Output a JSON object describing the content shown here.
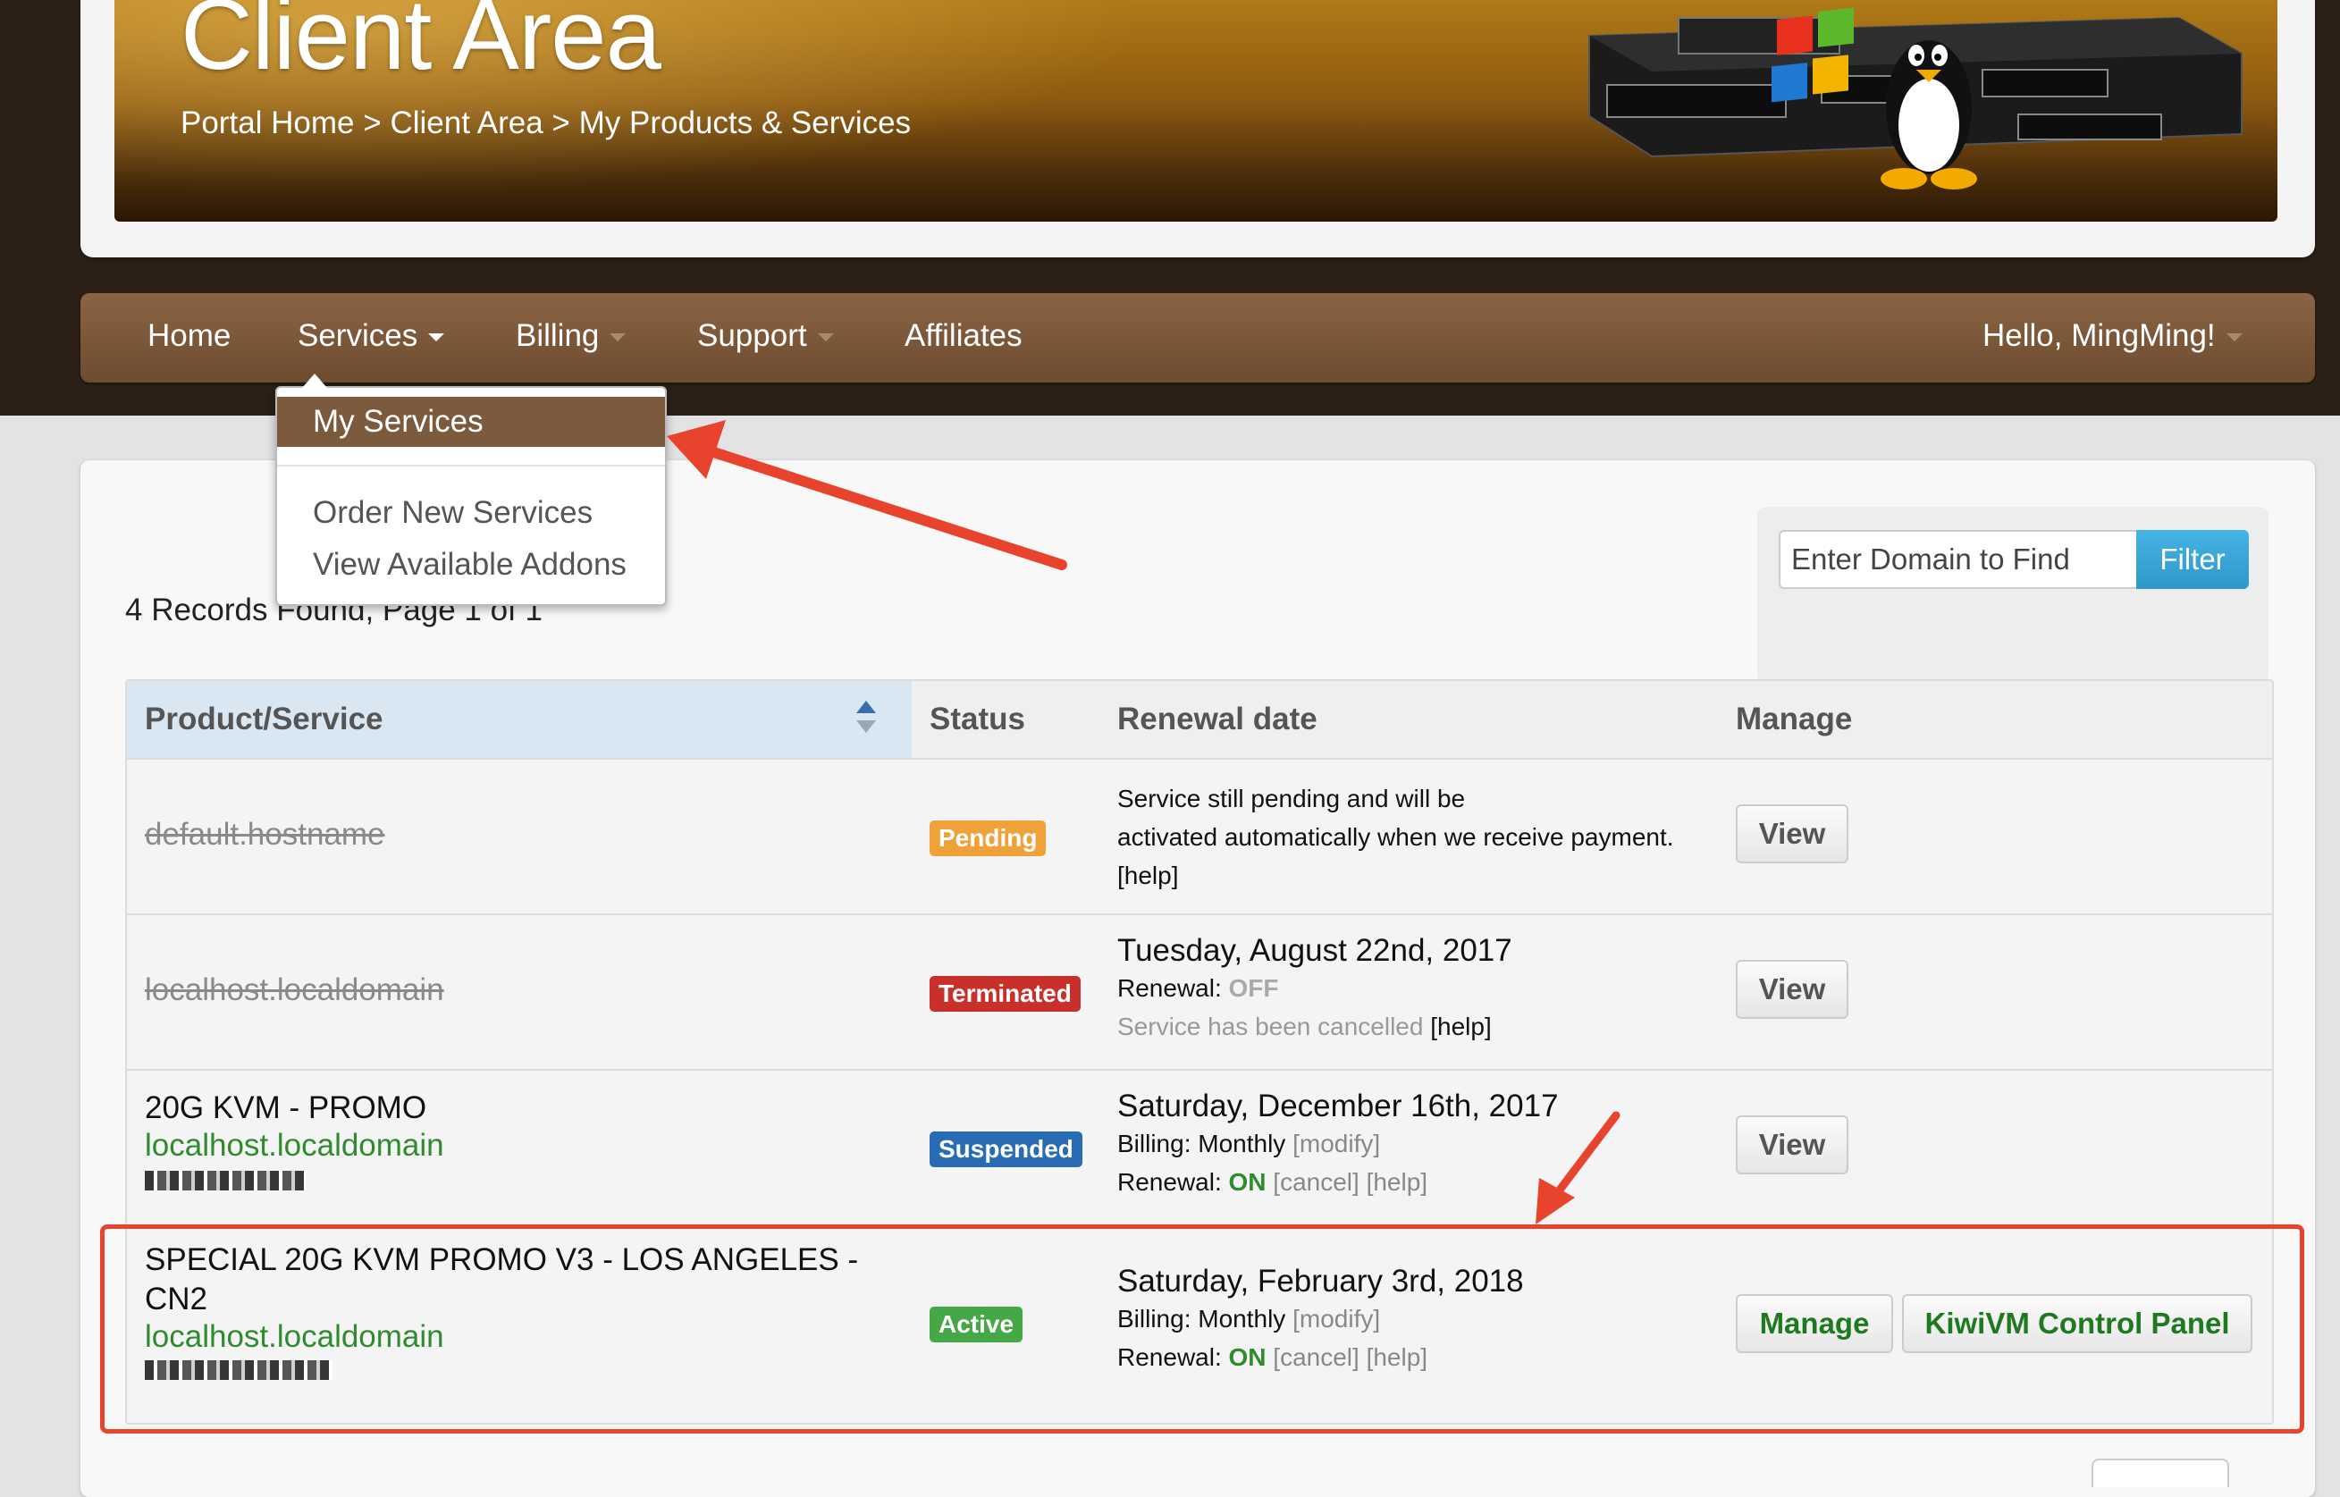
{
  "header": {
    "title": "Client Area",
    "breadcrumb": [
      "Portal Home",
      "Client Area",
      "My Products & Services"
    ],
    "breadcrumb_sep": ">"
  },
  "nav": {
    "home": "Home",
    "services": "Services",
    "billing": "Billing",
    "support": "Support",
    "affiliates": "Affiliates",
    "user": "Hello, MingMing!"
  },
  "dropdown": {
    "items": [
      "My Services",
      "Order New Services",
      "View Available Addons"
    ]
  },
  "records_text": "4 Records Found, Page 1 of 1",
  "filter": {
    "placeholder": "Enter Domain to Find",
    "button": "Filter"
  },
  "table": {
    "headers": [
      "Product/Service",
      "Status",
      "Renewal date",
      "Manage"
    ],
    "rows": [
      {
        "product": "default.hostname",
        "status": "Pending",
        "renewal_lines": [
          "Service still pending and will be",
          "activated automatically when we receive payment."
        ],
        "help": "[help]",
        "action": "View"
      },
      {
        "product": "localhost.localdomain",
        "status": "Terminated",
        "date": "Tuesday, August 22nd, 2017",
        "renewal_label": "Renewal:",
        "renewal_value": "OFF",
        "cancelled_text": "Service has been cancelled",
        "help": "[help]",
        "action": "View"
      },
      {
        "product": "20G KVM - PROMO",
        "domain": "localhost.localdomain",
        "status": "Suspended",
        "date": "Saturday, December 16th, 2017",
        "billing_label": "Billing: Monthly",
        "modify": "[modify]",
        "renewal_label": "Renewal:",
        "renewal_value": "ON",
        "cancel": "[cancel]",
        "help": "[help]",
        "action": "View"
      },
      {
        "product_line1": "SPECIAL 20G KVM PROMO V3 - LOS ANGELES -",
        "product_line2": "CN2",
        "domain": "localhost.localdomain",
        "status": "Active",
        "date": "Saturday, February 3rd, 2018",
        "billing_label": "Billing: Monthly",
        "modify": "[modify]",
        "renewal_label": "Renewal:",
        "renewal_value": "ON",
        "cancel": "[cancel]",
        "help": "[help]",
        "actions": [
          "Manage",
          "KiwiVM Control Panel"
        ]
      }
    ]
  },
  "colors": {
    "accent_brown": "#7b5a3d",
    "annotation_red": "#e8432c",
    "status_pending": "#f0a23a",
    "status_terminated": "#c9302c",
    "status_suspended": "#2a6cb3",
    "status_active": "#45a745",
    "filter_blue": "#2f98c9"
  }
}
